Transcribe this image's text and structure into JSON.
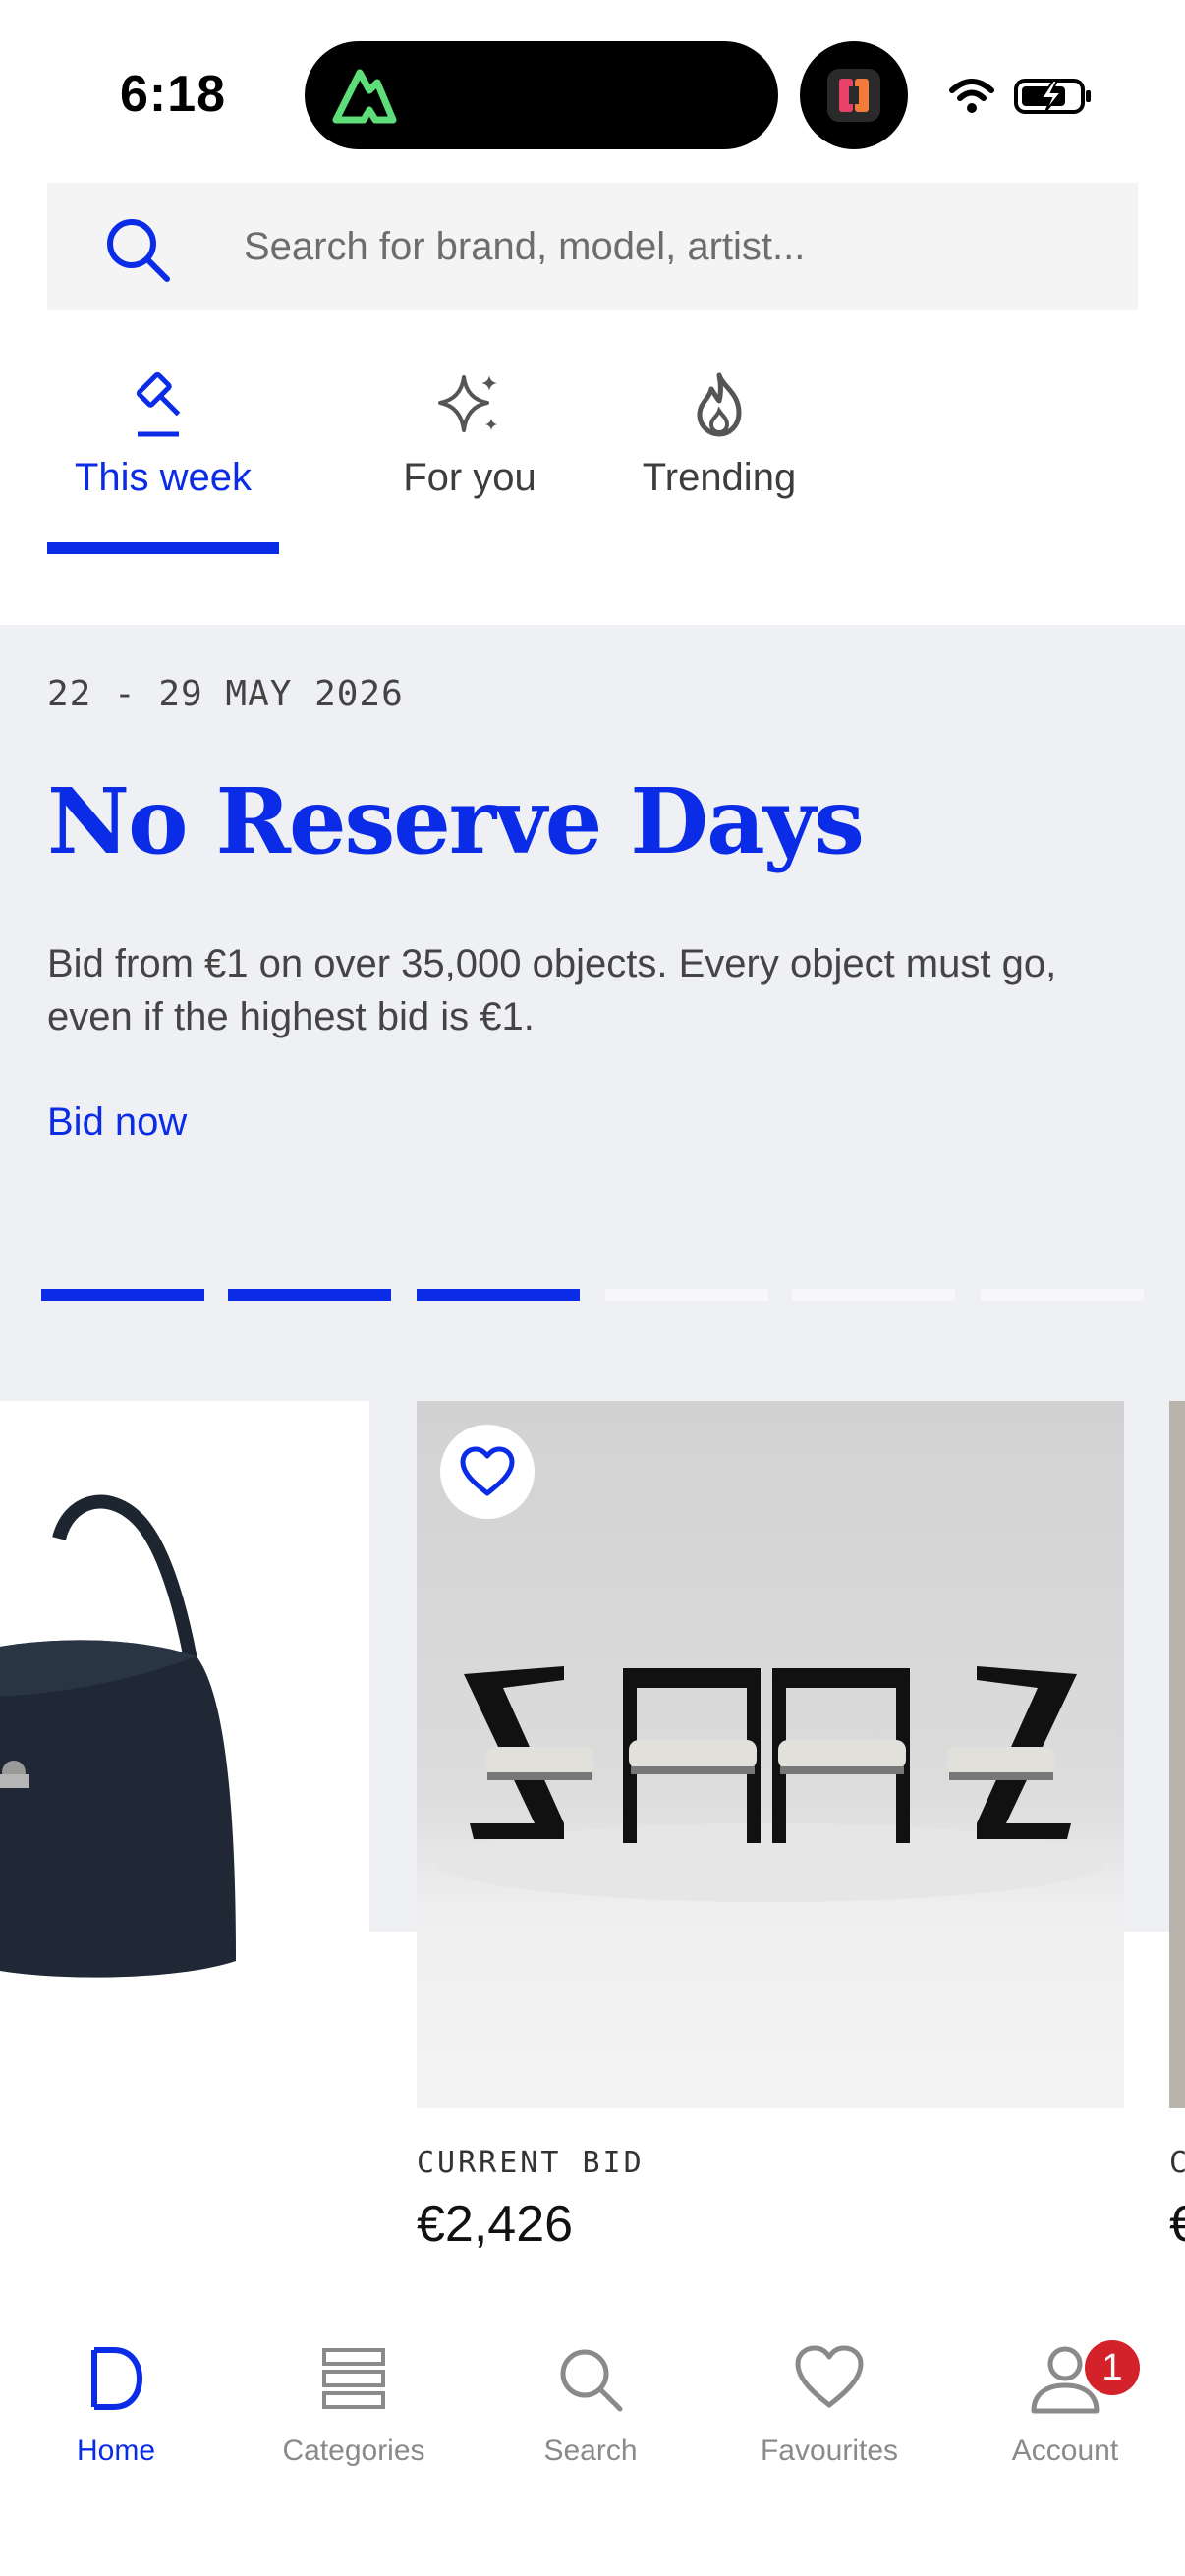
{
  "status_bar": {
    "time": "6:18",
    "icons": [
      "signal-app-icon",
      "wifi-icon",
      "battery-charging-icon"
    ]
  },
  "search": {
    "placeholder": "Search for brand, model, artist..."
  },
  "tabs": [
    {
      "label": "This week",
      "icon": "gavel-icon",
      "active": true
    },
    {
      "label": "For you",
      "icon": "sparkle-icon",
      "active": false
    },
    {
      "label": "Trending",
      "icon": "flame-icon",
      "active": false
    }
  ],
  "hero": {
    "date": "22 - 29 MAY 2026",
    "title": "No Reserve Days",
    "text": "Bid from €1 on over 35,000 objects. Every object must go, even if the highest bid is €1.",
    "cta": "Bid now",
    "carousel": {
      "total_slides": 6,
      "completed": 3
    }
  },
  "lots": [
    {
      "bid_label": "CURRENT BID",
      "bid_value": "€2,426",
      "favourite_icon": "heart-icon"
    }
  ],
  "next_lot": {
    "bid_label": "C",
    "bid_value": "€"
  },
  "bottom_nav": [
    {
      "label": "Home",
      "icon": "home-icon",
      "active": true
    },
    {
      "label": "Categories",
      "icon": "categories-icon",
      "active": false
    },
    {
      "label": "Search",
      "icon": "search-icon",
      "active": false
    },
    {
      "label": "Favourites",
      "icon": "heart-icon",
      "active": false
    },
    {
      "label": "Account",
      "icon": "account-icon",
      "active": false
    }
  ],
  "account_badge": "1",
  "colors": {
    "accent": "#0b2ce6",
    "hero_bg": "#eff0f4",
    "badge": "#d4222b"
  }
}
